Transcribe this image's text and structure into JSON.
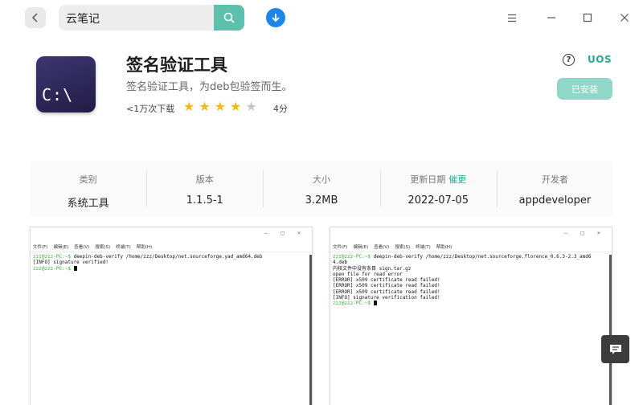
{
  "search": {
    "value": "云笔记"
  },
  "app": {
    "name": "签名验证工具",
    "description": "签名验证工具，为deb包验签而生。",
    "icon_text": "C:\\",
    "downloads": "<1万次下载",
    "rating": 4,
    "rating_max": 5,
    "score_label": "4分",
    "uos_badge": "UOS",
    "help_glyph": "?",
    "installed_label": "已安装"
  },
  "info": {
    "category_label": "类别",
    "category_value": "系统工具",
    "version_label": "版本",
    "version_value": "1.1.5-1",
    "size_label": "大小",
    "size_value": "3.2MB",
    "updated_label": "更新日期",
    "update_link": "催更",
    "updated_value": "2022-07-05",
    "developer_label": "开发者",
    "developer_value": "appdeveloper"
  },
  "screenshots": {
    "window_controls": "– □ ×",
    "menu": [
      "文件(F)",
      "编辑(E)",
      "查看(V)",
      "搜索(S)",
      "终端(T)",
      "帮助(H)"
    ],
    "left": {
      "line1_prompt": "zzz@zzz-PC:~$",
      "line1_cmd": " deepin-deb-verify /home/zzz/Desktop/net.sourceforge.yad_amd64.deb",
      "line2": "[INFO] signature verified!",
      "line3_prompt": "zzz@zzz-PC:~$"
    },
    "right": {
      "line1_prompt": "zzz@zzz-PC:~$",
      "line1_cmd": " deepin-deb-verify /home/zzz/Desktop/net.sourceforge.florence_0.6.3-2.3_amd6",
      "line2": "4.deb",
      "line3": "内核文件中没有条目 sign.tar.gz",
      "line4": "open file for read error",
      "line5": "[ERROR] x509 certificate read failed!",
      "line6": "[ERROR] x509 certificate read failed!",
      "line7": "[ERROR] x509 certificate read failed!",
      "line8": "[INFO] signature verification failed!",
      "line9_prompt": "zzz@zzz-PC:~$"
    }
  },
  "colors": {
    "accent": "#5cc0ac",
    "uos": "#2aa88f",
    "download": "#1e86ea",
    "star_on": "#f5b817",
    "star_off": "#c7c7c7",
    "installed_bg": "#8fd8c9"
  },
  "icons": [
    "back-icon",
    "search-icon",
    "download-icon",
    "menu-icon",
    "minimize-icon",
    "maximize-icon",
    "close-icon",
    "help-icon",
    "star-icon",
    "feedback-icon"
  ]
}
